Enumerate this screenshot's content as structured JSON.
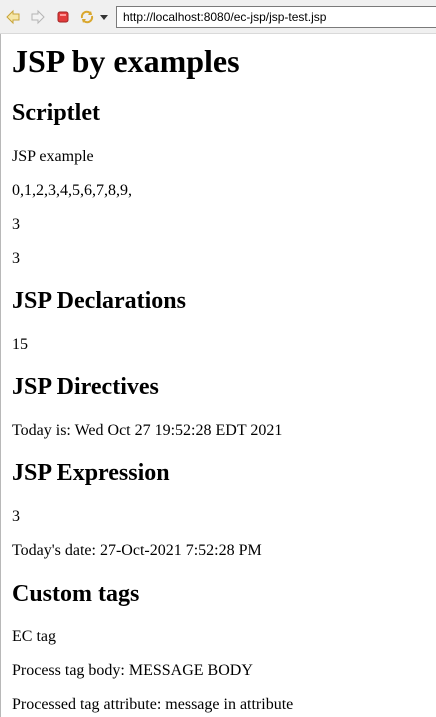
{
  "browser": {
    "url": "http://localhost:8080/ec-jsp/jsp-test.jsp",
    "icons": {
      "back": "arrow-left-icon",
      "forward": "arrow-right-icon",
      "stop": "stop-icon",
      "refresh": "refresh-icon",
      "menu": "chevron-down-icon"
    }
  },
  "page": {
    "title": "JSP by examples",
    "scriptlet": {
      "heading": "Scriptlet",
      "lines": [
        "JSP example",
        "0,1,2,3,4,5,6,7,8,9,",
        "3",
        "3"
      ]
    },
    "declarations": {
      "heading": "JSP Declarations",
      "lines": [
        "15"
      ]
    },
    "directives": {
      "heading": "JSP Directives",
      "lines": [
        "Today is: Wed Oct 27 19:52:28 EDT 2021"
      ]
    },
    "expression": {
      "heading": "JSP Expression",
      "lines": [
        "3",
        "Today's date: 27-Oct-2021 7:52:28 PM"
      ]
    },
    "custom_tags": {
      "heading": "Custom tags",
      "lines": [
        "EC tag",
        "Process tag body: MESSAGE BODY",
        "Processed tag attribute: message in attribute"
      ]
    }
  }
}
